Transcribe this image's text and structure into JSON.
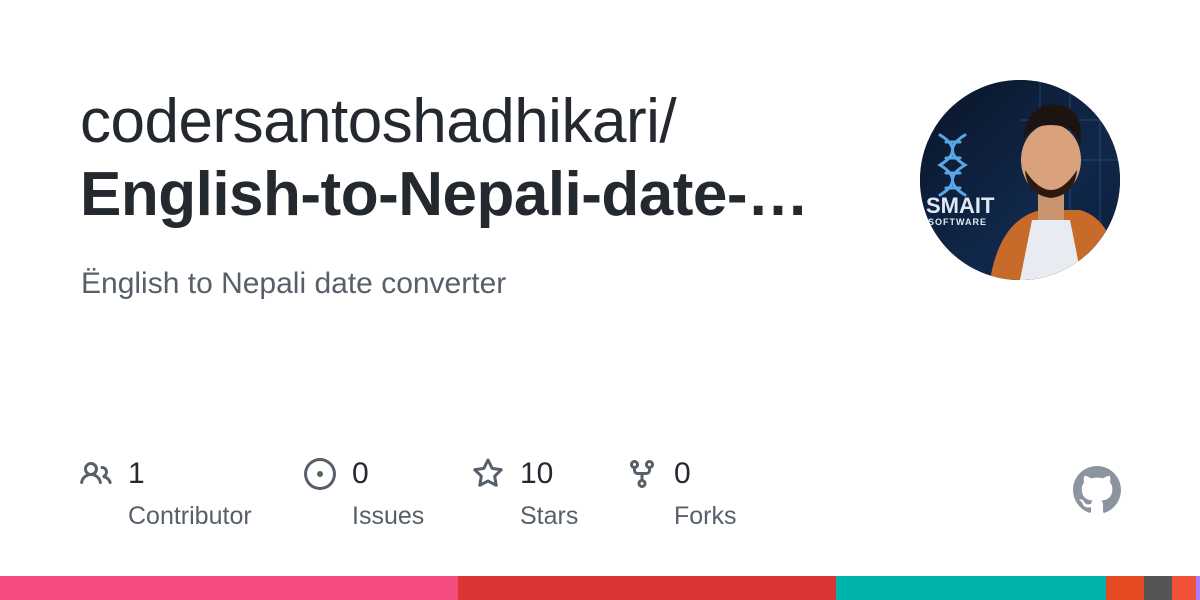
{
  "repo": {
    "owner": "codersantoshadhikari/",
    "name": "English-to-Nepali-date-…",
    "description": "Ënglish to Nepali date converter"
  },
  "avatar": {
    "logo_text": "SMAIT",
    "logo_subtext": "SOFTWARE"
  },
  "stats": {
    "contributors": {
      "value": "1",
      "label": "Contributor",
      "icon": "people-icon"
    },
    "issues": {
      "value": "0",
      "label": "Issues",
      "icon": "issue-opened-icon"
    },
    "stars": {
      "value": "10",
      "label": "Stars",
      "icon": "star-icon"
    },
    "forks": {
      "value": "0",
      "label": "Forks",
      "icon": "repo-forked-icon"
    }
  },
  "colors": {
    "text_primary": "#24292f",
    "text_secondary": "#57606a",
    "icon": "#57606a",
    "github_mark": "#8c959f"
  },
  "language_bar": [
    {
      "color": "#f34b7d",
      "share": 38.2
    },
    {
      "color": "#da3434",
      "share": 31.5
    },
    {
      "color": "#00b4ab",
      "share": 22.5
    },
    {
      "color": "#e44b23",
      "share": 3.1
    },
    {
      "color": "#555555",
      "share": 2.4
    },
    {
      "color": "#f05138",
      "share": 2.0
    },
    {
      "color": "#a97bff",
      "share": 0.3
    }
  ]
}
